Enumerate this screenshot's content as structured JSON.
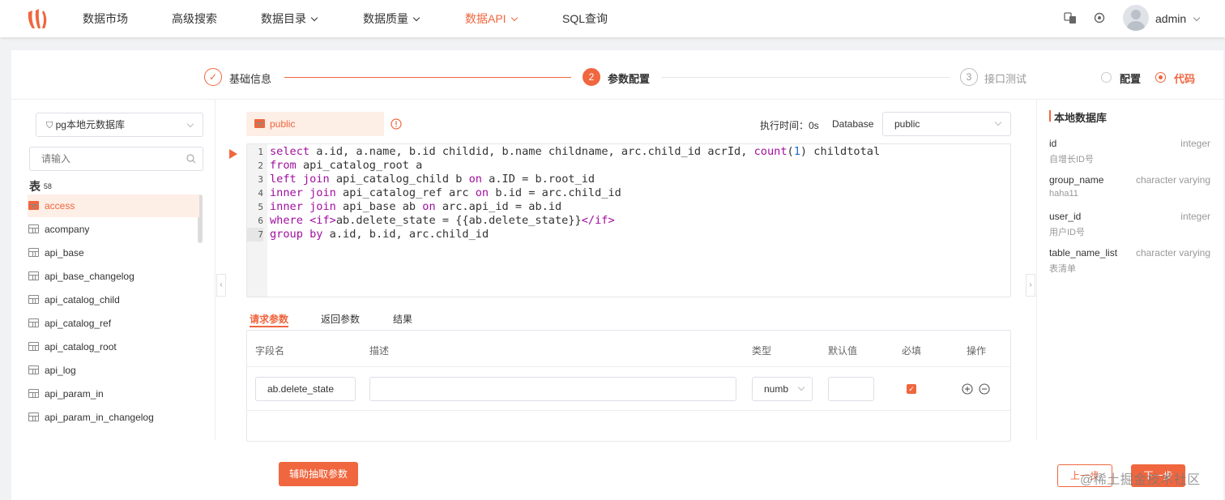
{
  "header": {
    "nav": [
      {
        "label": "数据市场"
      },
      {
        "label": "高级搜索"
      },
      {
        "label": "数据目录"
      },
      {
        "label": "数据质量"
      },
      {
        "label": "数据API"
      },
      {
        "label": "SQL查询"
      }
    ],
    "username": "admin"
  },
  "steps": [
    {
      "index": "1",
      "label": "基础信息",
      "state": "done"
    },
    {
      "index": "2",
      "label": "参数配置",
      "state": "active"
    },
    {
      "index": "3",
      "label": "接口测试",
      "state": "pending"
    }
  ],
  "mode": {
    "options": [
      "配置",
      "代码"
    ],
    "selected": "代码"
  },
  "left": {
    "datasource": "pg本地元数据库",
    "search_placeholder": "请输入",
    "tables_label": "表",
    "tables_count": "58",
    "tables": [
      "access",
      "acompany",
      "api_base",
      "api_base_changelog",
      "api_catalog_child",
      "api_catalog_ref",
      "api_catalog_root",
      "api_log",
      "api_param_in",
      "api_param_in_changelog"
    ],
    "selected_table": "access"
  },
  "editor_header": {
    "schema_tag": "public",
    "exec_time": "执行时间：0s",
    "database_label": "Database",
    "database_value": "public"
  },
  "code_lines": [
    [
      "1",
      "select a.id, a.name, b.id childid, b.name childname, arc.child_id acrId, count(1) childtotal"
    ],
    [
      "2",
      "from api_catalog_root a"
    ],
    [
      "3",
      "left join api_catalog_child b on a.ID = b.root_id"
    ],
    [
      "4",
      "inner join api_catalog_ref arc on b.id = arc.child_id"
    ],
    [
      "5",
      "inner join api_base ab on arc.api_id = ab.id"
    ],
    [
      "6",
      "where <if>ab.delete_state = {{ab.delete_state}}</if>"
    ],
    [
      "7",
      "group by a.id, b.id, arc.child_id"
    ]
  ],
  "param_tabs": [
    "请求参数",
    "返回参数",
    "结果"
  ],
  "param_tab_active": "请求参数",
  "params_table": {
    "headers": [
      "字段名",
      "描述",
      "类型",
      "默认值",
      "必填",
      "操作"
    ],
    "rows": [
      {
        "field": "ab.delete_state",
        "desc": "",
        "type": "numb",
        "default": "",
        "required": true
      }
    ]
  },
  "right": {
    "title": "本地数据库",
    "fields": [
      {
        "name": "id",
        "type": "integer",
        "desc": "自增长ID号"
      },
      {
        "name": "group_name",
        "type": "character varying",
        "desc": "haha11"
      },
      {
        "name": "user_id",
        "type": "integer",
        "desc": "用户ID号"
      },
      {
        "name": "table_name_list",
        "type": "character varying",
        "desc": "表清单"
      }
    ]
  },
  "footer": {
    "assist_button": "辅助抽取参数",
    "prev_button": "上一步",
    "next_button": "下一步"
  },
  "watermark": "@稀土掘金技术社区"
}
